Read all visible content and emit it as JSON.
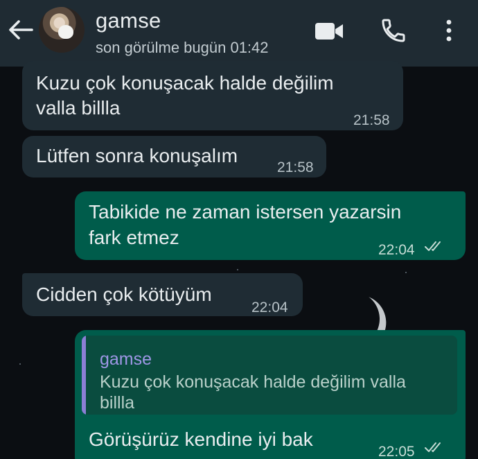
{
  "header": {
    "contact_name": "gamse",
    "last_seen": "son görülme bugün 01:42"
  },
  "icons": [
    "back-arrow-icon",
    "video-call-icon",
    "phone-icon",
    "more-vert-icon",
    "double-check-icon"
  ],
  "colors": {
    "header_bg": "#1f2b33",
    "incoming_bubble": "#1f2c34",
    "outgoing_bubble": "#005c4b",
    "quote_bar": "#8b7fd6"
  },
  "messages": [
    {
      "direction": "incoming",
      "lines": [
        "Kuzu çok konuşacak halde değilim",
        "valla billla"
      ],
      "time": "21:58"
    },
    {
      "direction": "incoming",
      "lines": [
        "Lütfen sonra konuşalım"
      ],
      "time": "21:58"
    },
    {
      "direction": "outgoing",
      "lines": [
        "Tabikide ne zaman istersen yazarsin",
        "fark etmez"
      ],
      "time": "22:04"
    },
    {
      "direction": "incoming",
      "lines": [
        "Cidden çok kötüyüm"
      ],
      "time": "22:04"
    },
    {
      "direction": "outgoing",
      "reply_to": {
        "name": "gamse",
        "lines": [
          "Kuzu çok konuşacak halde değilim valla",
          "billla"
        ]
      },
      "lines": [
        "Görüşürüz kendine iyi bak"
      ],
      "time": "22:05"
    }
  ]
}
